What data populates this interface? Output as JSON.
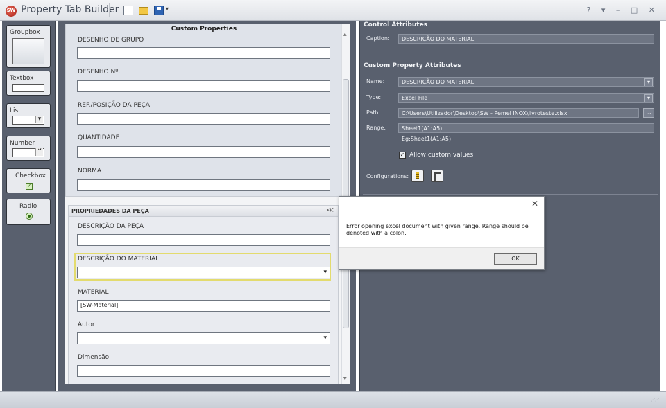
{
  "app": {
    "logo_text": "SW",
    "title": "Property Tab Builder",
    "window_controls": "? ▾ – □ ✕"
  },
  "toolbox": {
    "items": [
      {
        "label": "Groupbox"
      },
      {
        "label": "Textbox"
      },
      {
        "label": "List"
      },
      {
        "label": "Number"
      },
      {
        "label": "Checkbox"
      },
      {
        "label": "Radio"
      }
    ]
  },
  "form": {
    "title": "Custom Properties",
    "group1": {
      "fields": [
        {
          "label": "DESENHO DE GRUPO",
          "value": ""
        },
        {
          "label": "DESENHO Nº.",
          "value": ""
        },
        {
          "label": "REF./POSIÇÃO DA PEÇA",
          "value": ""
        },
        {
          "label": "QUANTIDADE",
          "value": ""
        },
        {
          "label": "NORMA",
          "value": ""
        }
      ]
    },
    "group2": {
      "title": "PROPRIEDADES DA PEÇA",
      "chevron": "≪",
      "fields": [
        {
          "label": "DESCRIÇÃO DA PEÇA",
          "value": ""
        },
        {
          "label": "DESCRIÇÃO DO MATERIAL",
          "value": ""
        },
        {
          "label": "MATERIAL",
          "value": "[SW-Material]"
        },
        {
          "label": "Autor",
          "value": ""
        },
        {
          "label": "Dimensão",
          "value": ""
        }
      ]
    }
  },
  "attributes": {
    "control_title": "Control Attributes",
    "caption_label": "Caption:",
    "caption_value": "DESCRIÇÃO DO MATERIAL",
    "custom_title": "Custom Property Attributes",
    "name_label": "Name:",
    "name_value": "DESCRIÇÃO DO MATERIAL",
    "type_label": "Type:",
    "type_value": "Excel File",
    "path_label": "Path:",
    "path_value": "C:\\Users\\Utilizador\\Desktop\\SW - Pemel INOX\\livroteste.xlsx",
    "browse_label": "...",
    "range_label": "Range:",
    "range_value": "Sheet1(A1:A5)",
    "range_hint": "Eg:Sheet1(A1:A5)",
    "allow_custom_label": "Allow custom values",
    "allow_custom_checked": true,
    "configurations_label": "Configurations:"
  },
  "dialog": {
    "close": "✕",
    "message": "Error opening excel document with given range. Range should be denoted with a colon.",
    "ok_label": "OK"
  },
  "colors": {
    "panel_bg": "#59606e",
    "selection_border": "#e3db6e"
  }
}
